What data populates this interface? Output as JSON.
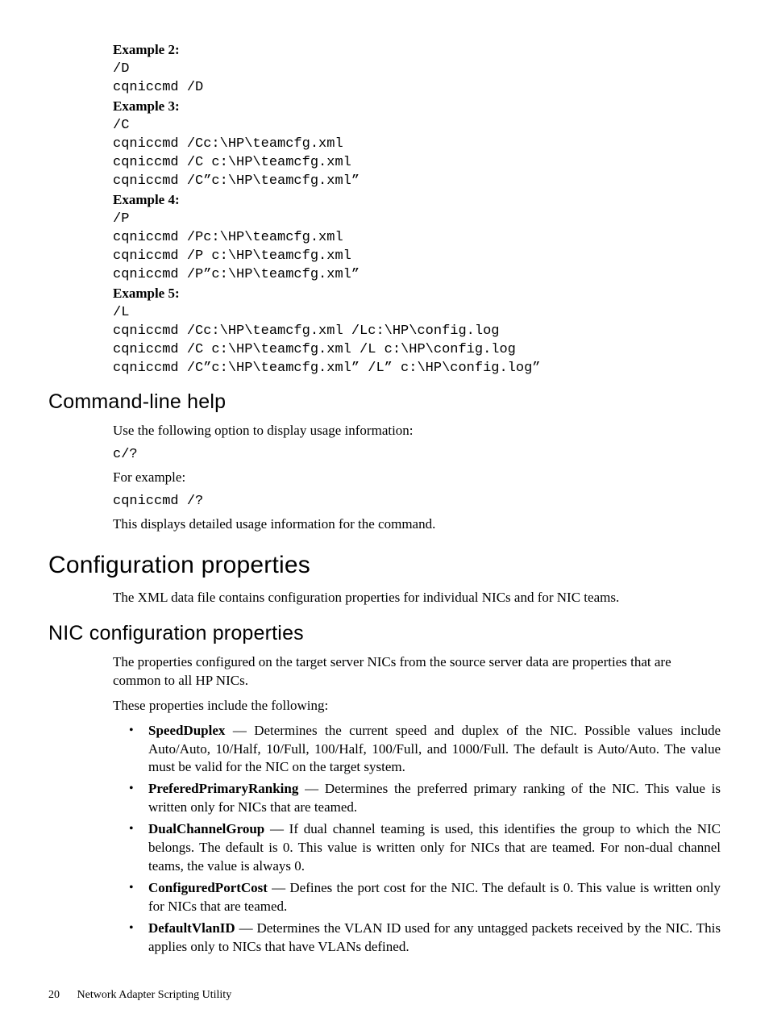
{
  "examples": {
    "ex2": {
      "label": "Example 2:",
      "flag": "/D",
      "lines": [
        "cqniccmd /D"
      ]
    },
    "ex3": {
      "label": "Example 3:",
      "flag": "/C",
      "lines": [
        "cqniccmd /Cc:\\HP\\teamcfg.xml",
        "cqniccmd /C c:\\HP\\teamcfg.xml",
        "cqniccmd /C”c:\\HP\\teamcfg.xml”"
      ]
    },
    "ex4": {
      "label": "Example 4:",
      "flag": "/P",
      "lines": [
        "cqniccmd /Pc:\\HP\\teamcfg.xml",
        "cqniccmd /P c:\\HP\\teamcfg.xml",
        "cqniccmd /P”c:\\HP\\teamcfg.xml”"
      ]
    },
    "ex5": {
      "label": "Example 5:",
      "flag": "/L",
      "lines": [
        "cqniccmd /Cc:\\HP\\teamcfg.xml /Lc:\\HP\\config.log",
        "cqniccmd /C c:\\HP\\teamcfg.xml /L c:\\HP\\config.log",
        "cqniccmd /C”c:\\HP\\teamcfg.xml” /L” c:\\HP\\config.log”"
      ]
    }
  },
  "cmdhelp": {
    "heading": "Command-line help",
    "intro": "Use the following option to display usage information:",
    "option": "c/?",
    "for_example": "For example:",
    "example_cmd": "cqniccmd /?",
    "outro": "This displays detailed usage information for the command."
  },
  "config": {
    "heading": "Configuration properties",
    "intro": "The XML data file contains configuration properties for individual NICs and for NIC teams."
  },
  "nicconfig": {
    "heading": "NIC configuration properties",
    "p1": "The properties configured on the target server NICs from the source server data are properties that are common to all HP NICs.",
    "p2": "These properties include the following:",
    "props": [
      {
        "name": "SpeedDuplex",
        "desc": " — Determines the current speed and duplex of the NIC. Possible values include Auto/Auto, 10/Half, 10/Full, 100/Half, 100/Full, and 1000/Full. The default is Auto/Auto. The value must be valid for the NIC on the target system."
      },
      {
        "name": "PreferedPrimaryRanking",
        "desc": " — Determines the preferred primary ranking of the NIC. This value is written only for NICs that are teamed."
      },
      {
        "name": "DualChannelGroup",
        "desc": " — If dual channel teaming is used, this identifies the group to which the NIC belongs. The default is 0. This value is written only for NICs that are teamed. For non-dual channel teams, the value is always 0."
      },
      {
        "name": "ConfiguredPortCost",
        "desc": " — Defines the port cost for the NIC. The default is 0. This value is written only for NICs that are teamed."
      },
      {
        "name": "DefaultVlanID",
        "desc": " — Determines the VLAN ID used for any untagged packets received by the NIC. This applies only to NICs that have VLANs defined."
      }
    ]
  },
  "footer": {
    "page": "20",
    "title": "Network Adapter Scripting Utility"
  }
}
